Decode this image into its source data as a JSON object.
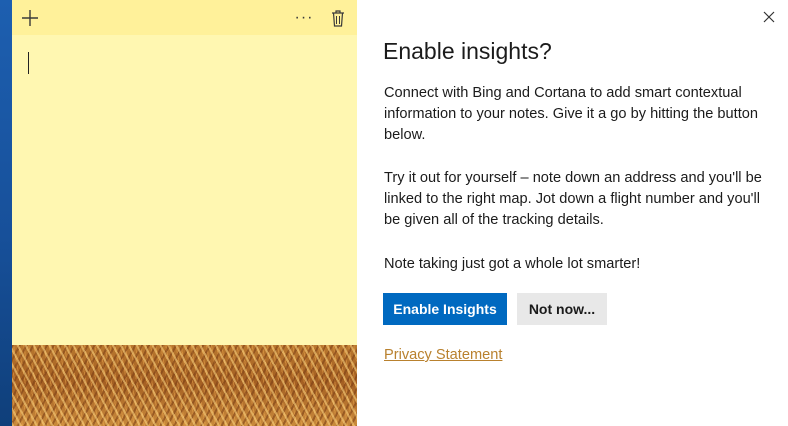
{
  "note": {
    "toolbar": {
      "add_icon": "plus-icon",
      "more_icon": "ellipsis-icon",
      "more_label": "···",
      "delete_icon": "trash-icon"
    },
    "content": "",
    "colors": {
      "body": "#fff7b1",
      "header": "#fff19a"
    }
  },
  "dialog": {
    "close_icon": "close-icon",
    "title": "Enable insights?",
    "paragraphs": [
      "Connect with Bing and Cortana to add smart contextual information to your notes. Give it a go by hitting the button below.",
      "Try it out for yourself – note down an address and you'll be linked to the right map. Jot down a flight number and you'll be given all of the tracking details.",
      "Note taking just got a whole lot smarter!"
    ],
    "buttons": {
      "enable": "Enable Insights",
      "not_now": "Not now..."
    },
    "privacy_link": "Privacy Statement",
    "colors": {
      "primary": "#0069c0",
      "secondary": "#e8e8e8",
      "link": "#b9812e"
    }
  }
}
